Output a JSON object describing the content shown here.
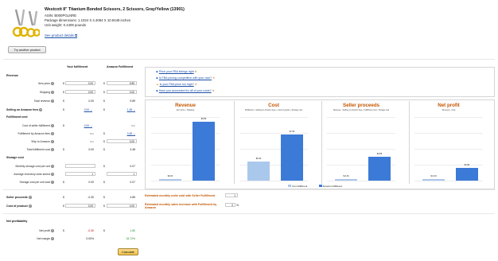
{
  "product": {
    "title": "Westcott 8\" Titanium Bonded Scissors, 2 Scissors, Gray/Yellow (13901)",
    "asin": "ASIN: B000PGLNRE",
    "dimensions": "Package dimensions: 1.1024 X 4.4094 X 10.9449 inches",
    "weight": "Unit weight: 0.4409 pounds",
    "details_link": "See product details",
    "try_button": "Try another product"
  },
  "columns": {
    "yours": "Your fulfillment",
    "amazon": "Amazon Fulfillment"
  },
  "revenue": {
    "header": "Revenue",
    "item_price": {
      "label": "Item price",
      "yours": "0.00",
      "amazon": "9.89"
    },
    "shipping": {
      "label": "Shipping",
      "yours": "0.00",
      "amazon": "0.00"
    },
    "total_revenue": {
      "label": "Total revenue",
      "yours": "0.00",
      "amazon": "9.89"
    }
  },
  "selling_fees": {
    "label": "Selling on Amazon fees",
    "yours": "0.00",
    "amazon": "1.48"
  },
  "fulfillment": {
    "header": "Fulfillment cost",
    "cost_seller": {
      "label": "Cost of seller fulfillment",
      "yours": "0.00",
      "amazon": "N/A"
    },
    "fba_fees": {
      "label": "Fulfillment by Amazon fees",
      "yours": "N/A",
      "amazon": "3.48"
    },
    "ship_to_amazon": {
      "label": "Ship to Amazon",
      "yours": "N/A",
      "amazon": "0.00"
    },
    "total": {
      "label": "Total fulfillment cost",
      "yours": "0.00",
      "amazon": "3.48"
    }
  },
  "storage": {
    "header": "Storage cost",
    "monthly": {
      "label": "Monthly storage cost per unit",
      "yours": "",
      "amazon": "0.07"
    },
    "avg_inventory": {
      "label": "Average inventory units stored",
      "yours": "1",
      "amazon": "1"
    },
    "per_unit": {
      "label": "Storage cost per unit sold",
      "yours": "0.00",
      "amazon": "0.07"
    }
  },
  "seller_proceeds": {
    "label": "Seller proceeds",
    "yours": "-0.30",
    "amazon": "4.85"
  },
  "cost_of_product": {
    "label": "Cost of product",
    "yours": "0.00",
    "amazon": "0.00"
  },
  "net_profitability": {
    "header": "Net profitability",
    "net_profit": {
      "label": "Net profit",
      "yours": "-0.30",
      "amazon": "1.80"
    },
    "net_margin": {
      "label": "Net margin",
      "yours": "0.00%",
      "amazon": "18.72%"
    }
  },
  "currency": "$",
  "calculate_button": "Calculate",
  "tips": [
    "Price your FBA listings right",
    "Is FBA pricing competitive with your own?",
    "Is your FBA price too high?",
    "Have you accounted for all of your costs?"
  ],
  "charts": [
    {
      "title": "Revenue",
      "subtitle": "Item price + Shipping",
      "yours_label": "$0.00",
      "amazon_label": "$9.89"
    },
    {
      "title": "Cost",
      "subtitle": "Fulfillment + Selling on Amazon fees + Cost of goods + Storage cost",
      "yours_label": "$5.30",
      "amazon_label": "$7.96"
    },
    {
      "title": "Seller proceeds",
      "subtitle": "Revenue - Selling on Amazon fees - Fulfillment cost - Storage cost",
      "yours_label": "$-0.30",
      "amazon_label": "$4.85"
    },
    {
      "title": "Net profit",
      "subtitle": "Revenue - Cost",
      "yours_label": "$-0.30",
      "amazon_label": "$1.80"
    }
  ],
  "legend": {
    "yours": "Your fulfillment",
    "amazon": "Amazon fulfillment"
  },
  "estimates": {
    "units_label": "Estimated monthly units sold with Seller Fulfillment",
    "units_value": "1",
    "sales_label": "Estimated monthly sales increase with Fulfillment by Amazon",
    "sales_value": "0",
    "sales_unit": "%"
  },
  "colors": {
    "yours": "#aac8ec",
    "amazon": "#3c7ad8",
    "accent": "#c45500"
  }
}
